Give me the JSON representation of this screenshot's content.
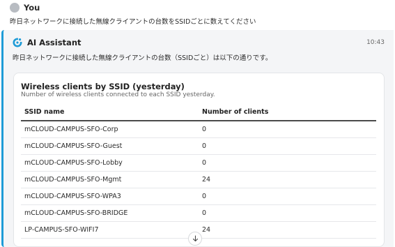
{
  "user": {
    "name": "You",
    "message": "昨日ネットワークに接続した無線クライアントの台数をSSIDごとに数えてください"
  },
  "assistant": {
    "name": "AI Assistant",
    "time": "10:43",
    "message": "昨日ネットワークに接続した無線クライアントの台数（SSIDごと）は以下の通りです。"
  },
  "card": {
    "title": "Wireless clients by SSID (yesterday)",
    "subtitle": "Number of wireless clients connected to each SSID yesterday.",
    "columns": [
      "SSID name",
      "Number of clients"
    ],
    "rows": [
      {
        "ssid": "mCLOUD-CAMPUS-SFO-Corp",
        "clients": "0"
      },
      {
        "ssid": "mCLOUD-CAMPUS-SFO-Guest",
        "clients": "0"
      },
      {
        "ssid": "mCLOUD-CAMPUS-SFO-Lobby",
        "clients": "0"
      },
      {
        "ssid": "mCLOUD-CAMPUS-SFO-Mgmt",
        "clients": "24"
      },
      {
        "ssid": "mCLOUD-CAMPUS-SFO-WPA3",
        "clients": "0"
      },
      {
        "ssid": "mCLOUD-CAMPUS-SFO-BRIDGE",
        "clients": "0"
      },
      {
        "ssid": "LP-CAMPUS-SFO-WIFI7",
        "clients": "24"
      }
    ]
  },
  "scroll_button_icon": "arrow-down-icon",
  "accent_color": "#1e9bd7"
}
